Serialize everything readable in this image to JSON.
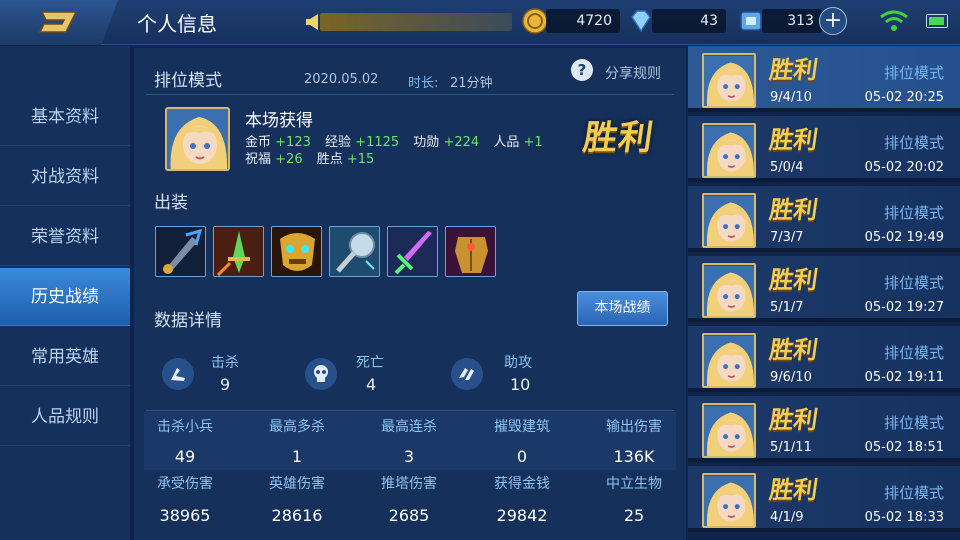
{
  "header": {
    "title": "个人信息",
    "resources": {
      "gold": "4720",
      "diamonds": "43",
      "vouchers": "313"
    },
    "plus_label": "+"
  },
  "sidebar": {
    "items": [
      {
        "label": "基本资料"
      },
      {
        "label": "对战资料"
      },
      {
        "label": "荣誉资料"
      },
      {
        "label": "历史战绩",
        "active": true
      },
      {
        "label": "常用英雄"
      },
      {
        "label": "人品规则"
      }
    ]
  },
  "match": {
    "mode": "排位模式",
    "date": "2020.05.02",
    "duration_label": "时长:",
    "duration": "21分钟",
    "help_icon": "?",
    "share_rules": "分享规则",
    "result": "胜利",
    "rewards_title": "本场获得",
    "rewards": [
      {
        "label": "金币",
        "value": "+123"
      },
      {
        "label": "经验",
        "value": "+1125"
      },
      {
        "label": "功勋",
        "value": "+224"
      },
      {
        "label": "人品",
        "value": "+1"
      },
      {
        "label": "祝福",
        "value": "+26"
      },
      {
        "label": "胜点",
        "value": "+15"
      }
    ],
    "equipment_title": "出装",
    "equipment_icons": [
      "blade-item-icon",
      "green-sword-item-icon",
      "golden-mask-item-icon",
      "hammer-item-icon",
      "crystal-sword-item-icon",
      "golden-armor-item-icon"
    ],
    "details_title": "数据详情",
    "details_button": "本场战绩",
    "kda": [
      {
        "label": "击杀",
        "value": "9",
        "icon": "kill-icon"
      },
      {
        "label": "死亡",
        "value": "4",
        "icon": "skull-icon"
      },
      {
        "label": "助攻",
        "value": "10",
        "icon": "assist-icon"
      }
    ],
    "stats": [
      {
        "label": "击杀小兵",
        "value": "49"
      },
      {
        "label": "最高多杀",
        "value": "1"
      },
      {
        "label": "最高连杀",
        "value": "3"
      },
      {
        "label": "摧毁建筑",
        "value": "0"
      },
      {
        "label": "输出伤害",
        "value": "136K"
      },
      {
        "label": "承受伤害",
        "value": "38965"
      },
      {
        "label": "英雄伤害",
        "value": "28616"
      },
      {
        "label": "推塔伤害",
        "value": "2685"
      },
      {
        "label": "获得金钱",
        "value": "29842"
      },
      {
        "label": "中立生物",
        "value": "25"
      }
    ]
  },
  "history": [
    {
      "result": "胜利",
      "kda": "9/4/10",
      "mode": "排位模式",
      "time": "05-02 20:25",
      "selected": true
    },
    {
      "result": "胜利",
      "kda": "5/0/4",
      "mode": "排位模式",
      "time": "05-02 20:02"
    },
    {
      "result": "胜利",
      "kda": "7/3/7",
      "mode": "排位模式",
      "time": "05-02 19:49"
    },
    {
      "result": "胜利",
      "kda": "5/1/7",
      "mode": "排位模式",
      "time": "05-02 19:27"
    },
    {
      "result": "胜利",
      "kda": "9/6/10",
      "mode": "排位模式",
      "time": "05-02 19:11"
    },
    {
      "result": "胜利",
      "kda": "5/1/11",
      "mode": "排位模式",
      "time": "05-02 18:51"
    },
    {
      "result": "胜利",
      "kda": "4/1/9",
      "mode": "排位模式",
      "time": "05-02 18:33"
    }
  ],
  "colors": {
    "accent": "#3b8ad8",
    "victory": "#f3cc53",
    "gain": "#6ee36a",
    "label_blue": "#8ec3f2"
  }
}
